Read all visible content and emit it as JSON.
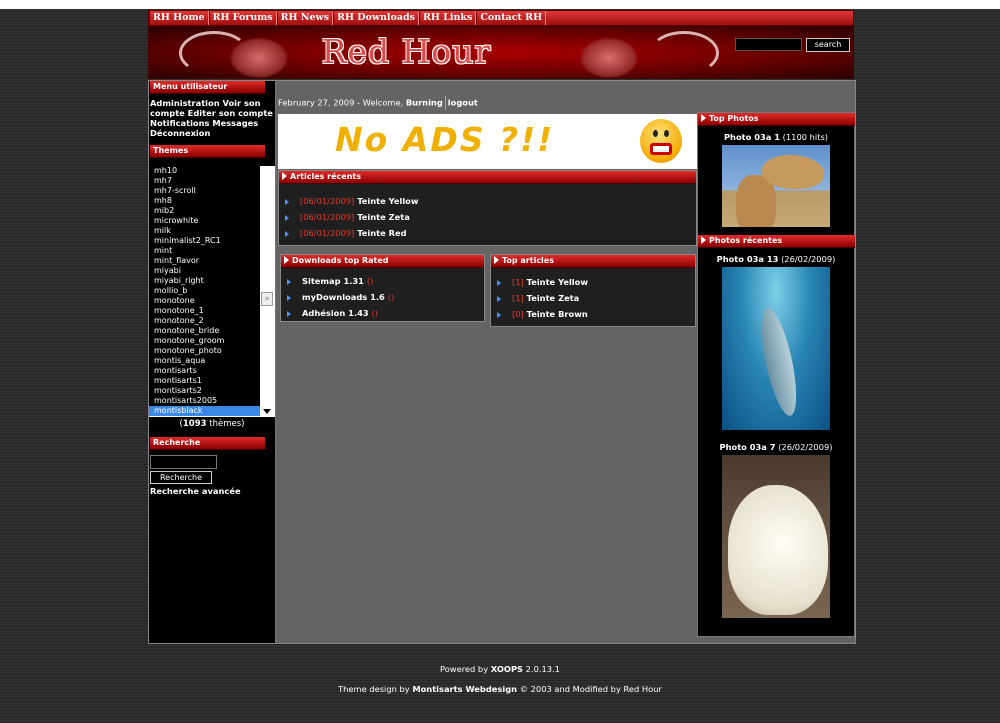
{
  "nav": [
    "RH Home",
    "RH Forums",
    "RH News",
    "RH Downloads",
    "RH Links",
    "Contact RH"
  ],
  "header": {
    "logo": "Red Hour",
    "search_button": "search"
  },
  "user_menu": {
    "title": "Menu utilisateur",
    "text": "Administration Voir son compte Editer son compte Notifications Messages Déconnexion"
  },
  "themes": {
    "title": "Themes",
    "items": [
      "mh10",
      "mh7",
      "mh7-scroll",
      "mh8",
      "mib2",
      "microwhite",
      "milk",
      "minimalist2_RC1",
      "mint",
      "mint_flavor",
      "miyabi",
      "miyabi_right",
      "mollio_b",
      "monotone",
      "monotone_1",
      "monotone_2",
      "monotone_bride",
      "monotone_groom",
      "monotone_photo",
      "montis_aqua",
      "montisarts",
      "montisarts1",
      "montisarts2",
      "montisarts2005",
      "montisblack"
    ],
    "selected": "montisblack",
    "count_prefix": "(",
    "count": "1093",
    "count_suffix": " thèmes)"
  },
  "search": {
    "title": "Recherche",
    "button": "Recherche",
    "advanced": "Recherche avancée"
  },
  "welcome": {
    "date": "February 27, 2009",
    "text": " - Welcome, ",
    "user": "Burning",
    "logout": "logout"
  },
  "banner": {
    "text": "No ADS ?!!"
  },
  "recent_articles": {
    "title": "Articles récents",
    "items": [
      {
        "date": "[06/01/2009]",
        "title": "Teinte Yellow"
      },
      {
        "date": "[06/01/2009]",
        "title": "Teinte Zeta"
      },
      {
        "date": "[06/01/2009]",
        "title": "Teinte Red"
      }
    ]
  },
  "downloads": {
    "title": "Downloads top Rated",
    "items": [
      {
        "name": "Sitemap 1.31",
        "rating": "()"
      },
      {
        "name": "myDownloads 1.6",
        "rating": "()"
      },
      {
        "name": "Adhésion 1.43",
        "rating": "()"
      }
    ]
  },
  "top_articles": {
    "title": "Top articles",
    "items": [
      {
        "count": "[1]",
        "title": "Teinte Yellow"
      },
      {
        "count": "[1]",
        "title": "Teinte Zeta"
      },
      {
        "count": "[0]",
        "title": "Teinte Brown"
      }
    ]
  },
  "top_photos": {
    "title": "Top Photos",
    "photo": {
      "name": "Photo 03a 1",
      "meta": " (1100 hits)"
    }
  },
  "recent_photos": {
    "title": "Photos récentes",
    "photos": [
      {
        "name": "Photo 03a 13",
        "meta": " (26/02/2009)"
      },
      {
        "name": "Photo 03a 7",
        "meta": " (26/02/2009)"
      }
    ]
  },
  "footer": {
    "powered_prefix": "Powered by ",
    "powered_name": "XOOPS",
    "powered_version": " 2.0.13.1",
    "design_prefix": "Theme design by ",
    "design_name": "Montisarts Webdesign",
    "design_suffix": " © 2003 and Modified by Red Hour"
  }
}
